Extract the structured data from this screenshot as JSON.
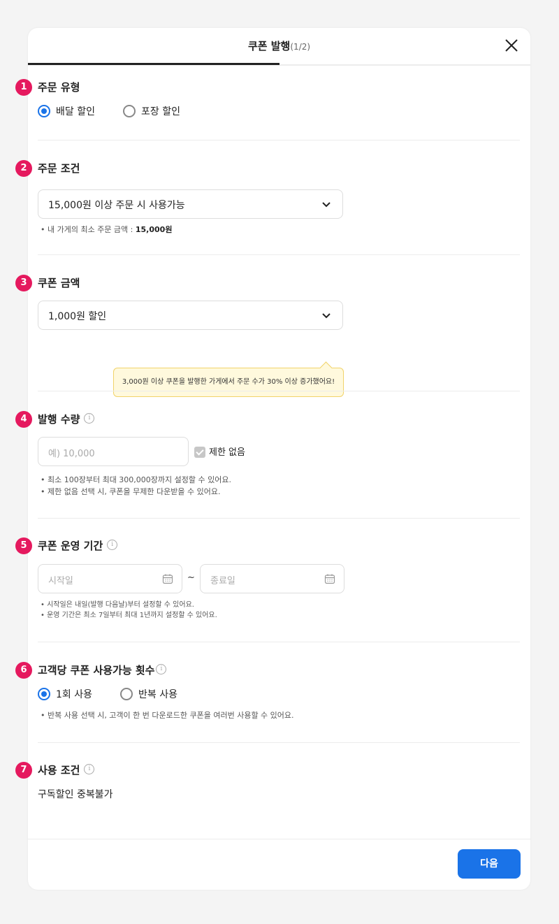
{
  "header": {
    "title": "쿠폰 발행",
    "step": "(1/2)",
    "progress": 0.5
  },
  "sections": [
    {
      "num": "1",
      "title": "주문 유형",
      "radios": [
        {
          "label": "배달 할인",
          "checked": true
        },
        {
          "label": "포장 할인",
          "checked": false
        }
      ]
    },
    {
      "num": "2",
      "title": "주문 조건",
      "select_value": "15,000원 이상 주문 시 사용가능",
      "note_prefix": "• 내 가게의 최소 주문 금액 : ",
      "note_value": "15,000원"
    },
    {
      "num": "3",
      "title": "쿠폰 금액",
      "select_value": "1,000원 할인",
      "tooltip": "3,000원 이상 쿠폰을 발행한 가게에서 주문 수가 30% 이상 증가했어요!"
    },
    {
      "num": "4",
      "title": "발행 수량",
      "input_placeholder": "예) 10,000",
      "checkbox_label": "제한 없음",
      "checkbox_checked": true,
      "notes": [
        "• 최소 100장부터 최대 300,000장까지 설정할 수 있어요.",
        "• 제한 없음 선택 시, 쿠폰을 무제한 다운받을 수 있어요."
      ]
    },
    {
      "num": "5",
      "title": "쿠폰 운영 기간",
      "start_placeholder": "시작일",
      "tilde": "~",
      "end_placeholder": "종료일",
      "notes": [
        "• 시작일은 내일(발행 다음날)부터 설정할 수 있어요.",
        "• 운영 기간은 최소 7일부터 최대 1년까지 설정할 수 있어요."
      ]
    },
    {
      "num": "6",
      "title": "고객당 쿠폰 사용가능 횟수",
      "radios": [
        {
          "label": "1회 사용",
          "checked": true
        },
        {
          "label": "반복 사용",
          "checked": false
        }
      ],
      "note": "• 반복 사용 선택 시, 고객이 한 번 다운로드한 쿠폰을 여러번 사용할 수 있어요."
    },
    {
      "num": "7",
      "title": "사용 조건",
      "value": "구독할인 중복불가"
    }
  ],
  "info_icon": "i",
  "footer": {
    "next_label": "다음"
  },
  "colors": {
    "accent": "#1a73e8",
    "badge": "#e5195e",
    "tooltip_bg": "#fff9dd"
  }
}
